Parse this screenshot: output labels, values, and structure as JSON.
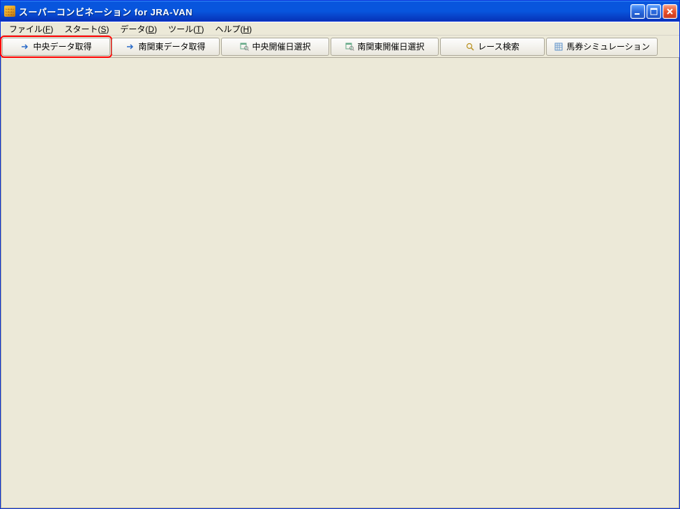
{
  "title": "スーパーコンビネーション for JRA-VAN",
  "menu": {
    "file": {
      "label": "ファイル",
      "accel": "F"
    },
    "start": {
      "label": "スタート",
      "accel": "S"
    },
    "data": {
      "label": "データ",
      "accel": "D"
    },
    "tool": {
      "label": "ツール",
      "accel": "T"
    },
    "help": {
      "label": "ヘルプ",
      "accel": "H"
    }
  },
  "toolbar": {
    "central_data": "中央データ取得",
    "nankan_data": "南関東データ取得",
    "central_date": "中央開催日選択",
    "nankan_date": "南関東開催日選択",
    "race_search": "レース検索",
    "ticket_sim": "馬券シミュレーション"
  }
}
